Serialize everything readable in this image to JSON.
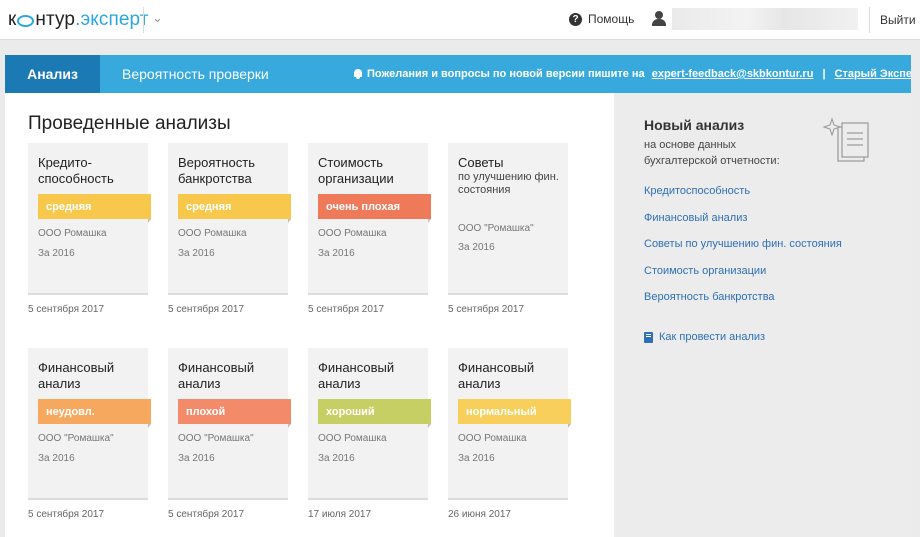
{
  "header": {
    "logo_main": "к",
    "logo_rest": "нтур",
    "logo_sub": ".эксперт",
    "help_label": "Помощь",
    "logout_label": "Выйти"
  },
  "navbar": {
    "tabs": [
      {
        "label": "Анализ",
        "active": true
      },
      {
        "label": "Вероятность проверки",
        "active": false
      }
    ],
    "notice_text": "Пожелания и вопросы по новой версии пишите на",
    "notice_email": "expert-feedback@skbkontur.ru",
    "notice_separator": "|",
    "notice_old": "Старый Эксперт"
  },
  "main": {
    "title": "Проведенные анализы",
    "cards": [
      {
        "title": "Кредито-способность",
        "subtitle": "",
        "badge": "средняя",
        "badge_color": "#f7c84b",
        "org": "ООО Ромашка",
        "period": "За 2016",
        "date": "5 сентября 2017"
      },
      {
        "title": "Вероятность банкротства",
        "subtitle": "",
        "badge": "средняя",
        "badge_color": "#f7c84b",
        "org": "ООО Ромашка",
        "period": "За 2016",
        "date": "5 сентября 2017"
      },
      {
        "title": "Стоимость организации",
        "subtitle": "",
        "badge": "очень плохая",
        "badge_color": "#ef7a5a",
        "org": "ООО Ромашка",
        "period": "За 2016",
        "date": "5 сентября 2017"
      },
      {
        "title": "Советы",
        "subtitle": "по улучшению фин. состояния",
        "badge": "",
        "badge_color": "",
        "org": "ООО \"Ромашка\"",
        "period": "За 2016",
        "date": "5 сентября 2017"
      },
      {
        "title": "Финансовый анализ",
        "subtitle": "",
        "badge": "неудовл.",
        "badge_color": "#f6a85f",
        "org": "ООО \"Ромашка\"",
        "period": "За 2016",
        "date": "5 сентября 2017"
      },
      {
        "title": "Финансовый анализ",
        "subtitle": "",
        "badge": "плохой",
        "badge_color": "#f38a69",
        "org": "ООО \"Ромашка\"",
        "period": "За 2016",
        "date": "5 сентября 2017"
      },
      {
        "title": "Финансовый анализ",
        "subtitle": "",
        "badge": "хороший",
        "badge_color": "#c6cf63",
        "org": "ООО Ромашка",
        "period": "За 2016",
        "date": "17 июля 2017"
      },
      {
        "title": "Финансовый анализ",
        "subtitle": "",
        "badge": "нормальный",
        "badge_color": "#f7cf5a",
        "org": "ООО Ромашка",
        "period": "За 2016",
        "date": "26 июня 2017"
      }
    ]
  },
  "sidebar": {
    "title": "Новый анализ",
    "description": "на основе данных бухгалтерской отчетности:",
    "links": [
      "Кредитоспособность",
      "Финансовый анализ",
      "Советы по улучшению фин. состояния",
      "Стоимость организации",
      "Вероятность банкротства"
    ],
    "howto": "Как провести анализ"
  }
}
